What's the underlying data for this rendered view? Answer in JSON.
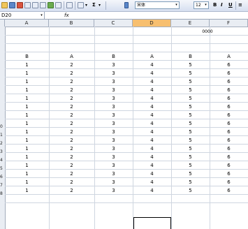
{
  "toolbar": {
    "font_name": "宋体",
    "font_size": "12",
    "bold_label": "B",
    "italic_label": "I",
    "underline_label": "U",
    "sigma_label": "Σ"
  },
  "formula_bar": {
    "name_box": "D20",
    "fx_label": "fx"
  },
  "columns": [
    {
      "label": "A",
      "selected": false
    },
    {
      "label": "B",
      "selected": false
    },
    {
      "label": "C",
      "selected": false
    },
    {
      "label": "D",
      "selected": true
    },
    {
      "label": "E",
      "selected": false
    },
    {
      "label": "F",
      "selected": false
    }
  ],
  "sheet": {
    "note": "0000",
    "header_row": [
      "B",
      "A",
      "B",
      "A",
      "B",
      "A"
    ],
    "rows": [
      [
        "1",
        "2",
        "3",
        "4",
        "5",
        "6"
      ],
      [
        "1",
        "2",
        "3",
        "4",
        "5",
        "6"
      ],
      [
        "1",
        "2",
        "3",
        "4",
        "5",
        "6"
      ],
      [
        "1",
        "2",
        "3",
        "4",
        "5",
        "6"
      ],
      [
        "1",
        "2",
        "3",
        "4",
        "5",
        "6"
      ],
      [
        "1",
        "2",
        "3",
        "4",
        "5",
        "6"
      ],
      [
        "1",
        "2",
        "3",
        "4",
        "5",
        "6"
      ],
      [
        "1",
        "2",
        "3",
        "4",
        "5",
        "6"
      ],
      [
        "1",
        "2",
        "3",
        "4",
        "5",
        "6"
      ],
      [
        "1",
        "2",
        "3",
        "4",
        "5",
        "6"
      ],
      [
        "1",
        "2",
        "3",
        "4",
        "5",
        "6"
      ],
      [
        "1",
        "2",
        "3",
        "4",
        "5",
        "6"
      ],
      [
        "1",
        "2",
        "3",
        "4",
        "5",
        "6"
      ],
      [
        "1",
        "2",
        "3",
        "4",
        "5",
        "6"
      ],
      [
        "1",
        "2",
        "3",
        "4",
        "5",
        "6"
      ],
      [
        "1",
        "2",
        "3",
        "4",
        "5",
        "6"
      ]
    ],
    "row_numbers": [
      "0",
      "1",
      "2",
      "3",
      "4",
      "5",
      "6",
      "7",
      "8"
    ]
  },
  "colors": {
    "selected_column": "#f7bf6f",
    "header_bg": "#e9edf3",
    "grid_line": "#cfd6e0"
  }
}
